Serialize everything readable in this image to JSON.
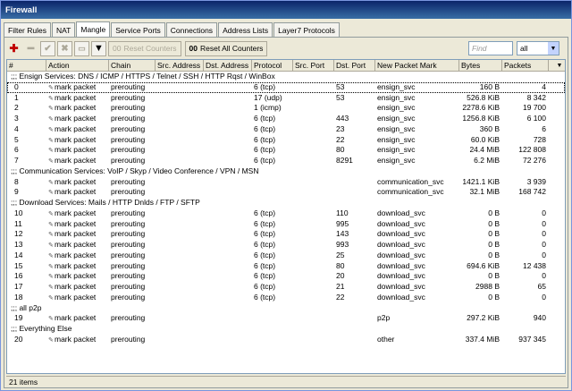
{
  "window": {
    "title": "Firewall"
  },
  "tabs": [
    {
      "label": "Filter Rules",
      "active": false
    },
    {
      "label": "NAT",
      "active": false
    },
    {
      "label": "Mangle",
      "active": true
    },
    {
      "label": "Service Ports",
      "active": false
    },
    {
      "label": "Connections",
      "active": false
    },
    {
      "label": "Address Lists",
      "active": false
    },
    {
      "label": "Layer7 Protocols",
      "active": false
    }
  ],
  "toolbar": {
    "add_icon": "plus-icon",
    "remove_icon": "minus-icon",
    "enable_icon": "check-icon",
    "disable_icon": "x-icon",
    "comment_icon": "comment-icon",
    "filter_icon": "filter-icon",
    "reset_counters_label": "Reset Counters",
    "reset_counters_icon": "00",
    "reset_all_counters_label": "Reset All Counters",
    "reset_all_counters_icon": "00",
    "find_placeholder": "Find",
    "filter_select_value": "all"
  },
  "columns": [
    "#",
    "Action",
    "Chain",
    "Src. Address",
    "Dst. Address",
    "Protocol",
    "Src. Port",
    "Dst. Port",
    "New Packet Mark",
    "Bytes",
    "Packets"
  ],
  "rows": [
    {
      "type": "comment",
      "text": ";;; Ensign Services: DNS / ICMP / HTTPS / Telnet / SSH / HTTP Rqst / WinBox"
    },
    {
      "type": "rule",
      "num": "0",
      "action": "mark packet",
      "chain": "prerouting",
      "src": "",
      "dst": "",
      "protocol": "6 (tcp)",
      "sport": "",
      "dport": "53",
      "mark": "ensign_svc",
      "bytes": "160 B",
      "packets": "4",
      "selected": true
    },
    {
      "type": "rule",
      "num": "1",
      "action": "mark packet",
      "chain": "prerouting",
      "src": "",
      "dst": "",
      "protocol": "17 (udp)",
      "sport": "",
      "dport": "53",
      "mark": "ensign_svc",
      "bytes": "526.8 KiB",
      "packets": "8 342"
    },
    {
      "type": "rule",
      "num": "2",
      "action": "mark packet",
      "chain": "prerouting",
      "src": "",
      "dst": "",
      "protocol": "1 (icmp)",
      "sport": "",
      "dport": "",
      "mark": "ensign_svc",
      "bytes": "2278.6 KiB",
      "packets": "19 700"
    },
    {
      "type": "rule",
      "num": "3",
      "action": "mark packet",
      "chain": "prerouting",
      "src": "",
      "dst": "",
      "protocol": "6 (tcp)",
      "sport": "",
      "dport": "443",
      "mark": "ensign_svc",
      "bytes": "1256.8 KiB",
      "packets": "6 100"
    },
    {
      "type": "rule",
      "num": "4",
      "action": "mark packet",
      "chain": "prerouting",
      "src": "",
      "dst": "",
      "protocol": "6 (tcp)",
      "sport": "",
      "dport": "23",
      "mark": "ensign_svc",
      "bytes": "360 B",
      "packets": "6"
    },
    {
      "type": "rule",
      "num": "5",
      "action": "mark packet",
      "chain": "prerouting",
      "src": "",
      "dst": "",
      "protocol": "6 (tcp)",
      "sport": "",
      "dport": "22",
      "mark": "ensign_svc",
      "bytes": "60.0 KiB",
      "packets": "728"
    },
    {
      "type": "rule",
      "num": "6",
      "action": "mark packet",
      "chain": "prerouting",
      "src": "",
      "dst": "",
      "protocol": "6 (tcp)",
      "sport": "",
      "dport": "80",
      "mark": "ensign_svc",
      "bytes": "24.4 MiB",
      "packets": "122 808"
    },
    {
      "type": "rule",
      "num": "7",
      "action": "mark packet",
      "chain": "prerouting",
      "src": "",
      "dst": "",
      "protocol": "6 (tcp)",
      "sport": "",
      "dport": "8291",
      "mark": "ensign_svc",
      "bytes": "6.2 MiB",
      "packets": "72 276"
    },
    {
      "type": "comment",
      "text": ";;; Communication Services: VoIP / Skyp / Video Conference / VPN / MSN"
    },
    {
      "type": "rule",
      "num": "8",
      "action": "mark packet",
      "chain": "prerouting",
      "src": "",
      "dst": "",
      "protocol": "",
      "sport": "",
      "dport": "",
      "mark": "communication_svc",
      "bytes": "1421.1 KiB",
      "packets": "3 939"
    },
    {
      "type": "rule",
      "num": "9",
      "action": "mark packet",
      "chain": "prerouting",
      "src": "",
      "dst": "",
      "protocol": "",
      "sport": "",
      "dport": "",
      "mark": "communication_svc",
      "bytes": "32.1 MiB",
      "packets": "168 742"
    },
    {
      "type": "comment",
      "text": ";;; Download Services: Mails / HTTP Dnlds / FTP / SFTP"
    },
    {
      "type": "rule",
      "num": "10",
      "action": "mark packet",
      "chain": "prerouting",
      "src": "",
      "dst": "",
      "protocol": "6 (tcp)",
      "sport": "",
      "dport": "110",
      "mark": "download_svc",
      "bytes": "0 B",
      "packets": "0"
    },
    {
      "type": "rule",
      "num": "11",
      "action": "mark packet",
      "chain": "prerouting",
      "src": "",
      "dst": "",
      "protocol": "6 (tcp)",
      "sport": "",
      "dport": "995",
      "mark": "download_svc",
      "bytes": "0 B",
      "packets": "0"
    },
    {
      "type": "rule",
      "num": "12",
      "action": "mark packet",
      "chain": "prerouting",
      "src": "",
      "dst": "",
      "protocol": "6 (tcp)",
      "sport": "",
      "dport": "143",
      "mark": "download_svc",
      "bytes": "0 B",
      "packets": "0"
    },
    {
      "type": "rule",
      "num": "13",
      "action": "mark packet",
      "chain": "prerouting",
      "src": "",
      "dst": "",
      "protocol": "6 (tcp)",
      "sport": "",
      "dport": "993",
      "mark": "download_svc",
      "bytes": "0 B",
      "packets": "0"
    },
    {
      "type": "rule",
      "num": "14",
      "action": "mark packet",
      "chain": "prerouting",
      "src": "",
      "dst": "",
      "protocol": "6 (tcp)",
      "sport": "",
      "dport": "25",
      "mark": "download_svc",
      "bytes": "0 B",
      "packets": "0"
    },
    {
      "type": "rule",
      "num": "15",
      "action": "mark packet",
      "chain": "prerouting",
      "src": "",
      "dst": "",
      "protocol": "6 (tcp)",
      "sport": "",
      "dport": "80",
      "mark": "download_svc",
      "bytes": "694.6 KiB",
      "packets": "12 438"
    },
    {
      "type": "rule",
      "num": "16",
      "action": "mark packet",
      "chain": "prerouting",
      "src": "",
      "dst": "",
      "protocol": "6 (tcp)",
      "sport": "",
      "dport": "20",
      "mark": "download_svc",
      "bytes": "0 B",
      "packets": "0"
    },
    {
      "type": "rule",
      "num": "17",
      "action": "mark packet",
      "chain": "prerouting",
      "src": "",
      "dst": "",
      "protocol": "6 (tcp)",
      "sport": "",
      "dport": "21",
      "mark": "download_svc",
      "bytes": "2988 B",
      "packets": "65"
    },
    {
      "type": "rule",
      "num": "18",
      "action": "mark packet",
      "chain": "prerouting",
      "src": "",
      "dst": "",
      "protocol": "6 (tcp)",
      "sport": "",
      "dport": "22",
      "mark": "download_svc",
      "bytes": "0 B",
      "packets": "0"
    },
    {
      "type": "comment",
      "text": ";;; all p2p"
    },
    {
      "type": "rule",
      "num": "19",
      "action": "mark packet",
      "chain": "prerouting",
      "src": "",
      "dst": "",
      "protocol": "",
      "sport": "",
      "dport": "",
      "mark": "p2p",
      "bytes": "297.2 KiB",
      "packets": "940"
    },
    {
      "type": "comment",
      "text": ";;; Everything Else"
    },
    {
      "type": "rule",
      "num": "20",
      "action": "mark packet",
      "chain": "prerouting",
      "src": "",
      "dst": "",
      "protocol": "",
      "sport": "",
      "dport": "",
      "mark": "other",
      "bytes": "337.4 MiB",
      "packets": "937 345"
    }
  ],
  "status": {
    "text": "21 items"
  }
}
